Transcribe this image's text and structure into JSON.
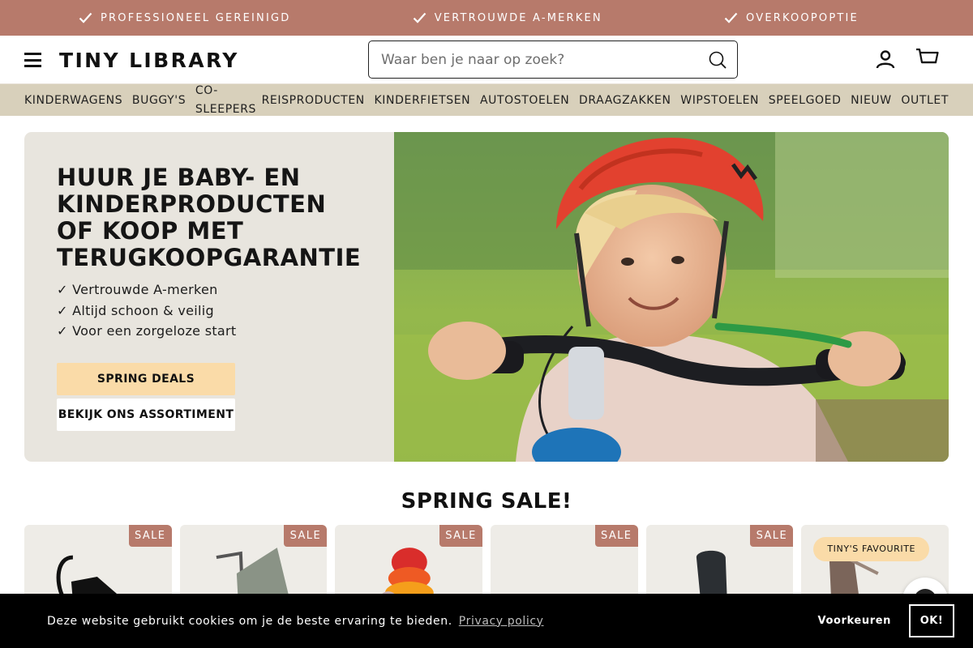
{
  "announcement": {
    "items": [
      {
        "label": "PROFESSIONEEL GEREINIGD",
        "icon": "check-icon"
      },
      {
        "label": "VERTROUWDE A-MERKEN",
        "icon": "check-icon"
      },
      {
        "label": "OVERKOOPOPTIE",
        "icon": "check-icon"
      }
    ],
    "background": "#b77a6b"
  },
  "header": {
    "logo": "TINY LIBRARY",
    "search_placeholder": "Waar ben je naar op zoek?",
    "icons": [
      "menu-icon",
      "search-icon",
      "user-icon",
      "cart-icon"
    ]
  },
  "categories": [
    "KINDERWAGENS",
    "BUGGY'S",
    "CO-SLEEPERS",
    "REISPRODUCTEN",
    "KINDERFIETSEN",
    "AUTOSTOELEN",
    "DRAAGZAKKEN",
    "WIPSTOELEN",
    "SPEELGOED",
    "NIEUW",
    "OUTLET"
  ],
  "hero": {
    "title": "HUUR JE BABY- EN KINDERPRODUCTEN OF KOOP MET TERUGKOOPGARANTIE",
    "bullets": [
      "✓ Vertrouwde A-merken",
      "✓ Altijd schoon & veilig",
      "✓ Voor een zorgeloze start"
    ],
    "primary_button": "SPRING DEALS",
    "secondary_button": "BEKIJK ONS ASSORTIMENT"
  },
  "sale": {
    "title": "SPRING SALE!",
    "products": [
      {
        "badge": "SALE",
        "badge_type": "sale"
      },
      {
        "badge": "SALE",
        "badge_type": "sale"
      },
      {
        "badge": "SALE",
        "badge_type": "sale"
      },
      {
        "badge": "SALE",
        "badge_type": "sale"
      },
      {
        "badge": "SALE",
        "badge_type": "sale"
      },
      {
        "badge": "TINY'S FAVOURITE",
        "badge_type": "favourite"
      }
    ]
  },
  "cookie": {
    "text": "Deze website gebruikt cookies om je de beste ervaring te bieden.",
    "link": "Privacy policy",
    "preferences": "Voorkeuren",
    "ok": "OK!"
  },
  "colors": {
    "accent": "#b77a6b",
    "nav_bg": "#d8d0bb",
    "button_peach": "#fadba8",
    "hero_bg": "#e8e5de"
  }
}
